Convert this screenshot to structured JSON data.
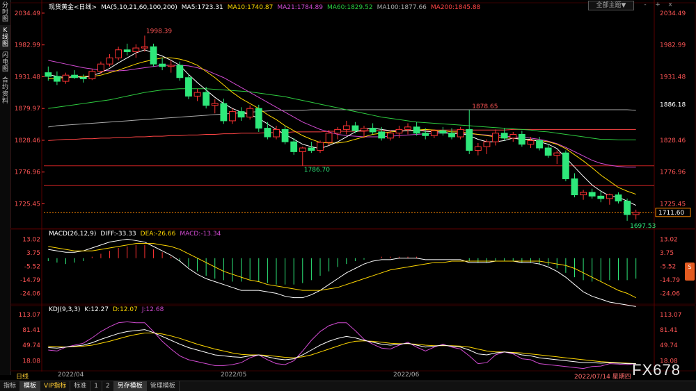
{
  "instrument": "现货黄金",
  "period": "日线",
  "sidebar": {
    "tabs": [
      {
        "label": "分时图",
        "active": false
      },
      {
        "label": "K线图",
        "active": true
      },
      {
        "label": "闪电图",
        "active": false
      },
      {
        "label": "合约资料",
        "active": false
      }
    ]
  },
  "toolbar": {
    "dropdown": "全部主题▼",
    "icons": [
      "-",
      "+",
      "x"
    ]
  },
  "ma_legend": {
    "title": "现货黄金<日线>",
    "params": "MA(5,10,21,60,100,200)",
    "items": [
      {
        "label": "MA5:1723.31",
        "color": "#ffffff"
      },
      {
        "label": "MA10:1740.87",
        "color": "#ffd700"
      },
      {
        "label": "MA21:1784.89",
        "color": "#d24bd2"
      },
      {
        "label": "MA60:1829.52",
        "color": "#2ecc40"
      },
      {
        "label": "MA100:1877.66",
        "color": "#aaaaaa"
      },
      {
        "label": "MA200:1845.88",
        "color": "#ff4444"
      }
    ]
  },
  "macd_legend": {
    "params": "MACD(26,12,9)",
    "items": [
      {
        "label": "DIFF:-33.33",
        "color": "#ffffff"
      },
      {
        "label": "DEA:-26.66",
        "color": "#ffd700"
      },
      {
        "label": "MACD:-13.34",
        "color": "#d24bd2"
      }
    ]
  },
  "kdj_legend": {
    "params": "KDJ(9,3,3)",
    "items": [
      {
        "label": "K:12.27",
        "color": "#ffffff"
      },
      {
        "label": "D:12.07",
        "color": "#ffd700"
      },
      {
        "label": "J:12.68",
        "color": "#d24bd2"
      }
    ]
  },
  "price_axis": {
    "ticks": [
      "2034.49",
      "1982.99",
      "1931.48",
      "1879.97",
      "1828.46",
      "1776.96",
      "1725.45"
    ],
    "right_ticks": [
      "2034.49",
      "1982.99",
      "1931.48",
      "1886.18",
      "1828.46",
      "1776.96",
      "1725.45"
    ],
    "current_price": "1711.60",
    "range": [
      1690,
      2040
    ]
  },
  "macd_axis": {
    "ticks": [
      "13.02",
      "3.75",
      "-5.52",
      "-14.79",
      "-24.06"
    ]
  },
  "kdj_axis": {
    "ticks": [
      "113.07",
      "81.41",
      "49.74",
      "18.08"
    ]
  },
  "annotations": {
    "high": "1998.39",
    "mid_high": "1878.65",
    "low_mid": "1786.70",
    "low": "1697.53"
  },
  "dates": [
    "2022/04",
    "2022/05",
    "2022/06"
  ],
  "date_readout": "2022/07/14 星期四",
  "chart_data": {
    "type": "candlestick",
    "candles": [
      [
        1938,
        1948,
        1925,
        1932
      ],
      [
        1932,
        1940,
        1918,
        1924
      ],
      [
        1924,
        1938,
        1920,
        1934
      ],
      [
        1934,
        1942,
        1928,
        1930
      ],
      [
        1930,
        1935,
        1922,
        1928
      ],
      [
        1928,
        1944,
        1926,
        1940
      ],
      [
        1940,
        1956,
        1936,
        1952
      ],
      [
        1952,
        1968,
        1948,
        1962
      ],
      [
        1962,
        1980,
        1958,
        1975
      ],
      [
        1975,
        1985,
        1966,
        1972
      ],
      [
        1972,
        1984,
        1962,
        1978
      ],
      [
        1978,
        1998,
        1972,
        1980
      ],
      [
        1980,
        1985,
        1948,
        1952
      ],
      [
        1952,
        1962,
        1942,
        1948
      ],
      [
        1948,
        1958,
        1938,
        1950
      ],
      [
        1950,
        1956,
        1925,
        1930
      ],
      [
        1930,
        1935,
        1895,
        1900
      ],
      [
        1900,
        1912,
        1892,
        1906
      ],
      [
        1906,
        1915,
        1880,
        1885
      ],
      [
        1885,
        1895,
        1872,
        1888
      ],
      [
        1888,
        1896,
        1855,
        1860
      ],
      [
        1860,
        1880,
        1855,
        1875
      ],
      [
        1875,
        1882,
        1860,
        1866
      ],
      [
        1866,
        1885,
        1862,
        1880
      ],
      [
        1880,
        1886,
        1842,
        1848
      ],
      [
        1848,
        1858,
        1830,
        1834
      ],
      [
        1834,
        1852,
        1830,
        1846
      ],
      [
        1846,
        1852,
        1822,
        1826
      ],
      [
        1826,
        1832,
        1805,
        1810
      ],
      [
        1810,
        1818,
        1787,
        1816
      ],
      [
        1816,
        1826,
        1808,
        1812
      ],
      [
        1812,
        1828,
        1808,
        1825
      ],
      [
        1825,
        1845,
        1820,
        1840
      ],
      [
        1840,
        1850,
        1830,
        1846
      ],
      [
        1846,
        1860,
        1838,
        1852
      ],
      [
        1852,
        1858,
        1840,
        1844
      ],
      [
        1844,
        1852,
        1832,
        1848
      ],
      [
        1848,
        1856,
        1838,
        1842
      ],
      [
        1842,
        1850,
        1828,
        1832
      ],
      [
        1832,
        1845,
        1828,
        1840
      ],
      [
        1840,
        1852,
        1832,
        1846
      ],
      [
        1846,
        1856,
        1838,
        1850
      ],
      [
        1850,
        1858,
        1836,
        1840
      ],
      [
        1840,
        1848,
        1830,
        1836
      ],
      [
        1836,
        1846,
        1832,
        1844
      ],
      [
        1844,
        1850,
        1836,
        1840
      ],
      [
        1840,
        1848,
        1830,
        1834
      ],
      [
        1834,
        1850,
        1830,
        1846
      ],
      [
        1846,
        1878,
        1806,
        1812
      ],
      [
        1812,
        1824,
        1804,
        1818
      ],
      [
        1818,
        1830,
        1806,
        1826
      ],
      [
        1826,
        1846,
        1820,
        1840
      ],
      [
        1840,
        1848,
        1828,
        1832
      ],
      [
        1832,
        1842,
        1826,
        1838
      ],
      [
        1838,
        1844,
        1818,
        1822
      ],
      [
        1822,
        1834,
        1816,
        1828
      ],
      [
        1828,
        1834,
        1812,
        1816
      ],
      [
        1816,
        1822,
        1800,
        1804
      ],
      [
        1804,
        1812,
        1790,
        1808
      ],
      [
        1808,
        1812,
        1762,
        1766
      ],
      [
        1766,
        1775,
        1736,
        1740
      ],
      [
        1740,
        1748,
        1732,
        1744
      ],
      [
        1744,
        1750,
        1734,
        1738
      ],
      [
        1738,
        1746,
        1728,
        1734
      ],
      [
        1734,
        1742,
        1724,
        1740
      ],
      [
        1740,
        1744,
        1726,
        1730
      ],
      [
        1730,
        1734,
        1698,
        1708
      ],
      [
        1708,
        1716,
        1700,
        1712
      ]
    ],
    "ma5": [
      1935,
      1932,
      1930,
      1932,
      1930,
      1933,
      1938,
      1945,
      1954,
      1962,
      1970,
      1975,
      1970,
      1965,
      1958,
      1950,
      1935,
      1922,
      1910,
      1898,
      1888,
      1880,
      1874,
      1870,
      1864,
      1855,
      1846,
      1838,
      1830,
      1822,
      1818,
      1815,
      1820,
      1826,
      1834,
      1842,
      1846,
      1848,
      1846,
      1844,
      1843,
      1844,
      1845,
      1843,
      1842,
      1842,
      1839,
      1840,
      1836,
      1830,
      1826,
      1826,
      1828,
      1832,
      1830,
      1830,
      1826,
      1822,
      1815,
      1800,
      1785,
      1770,
      1756,
      1746,
      1738,
      1736,
      1730,
      1723
    ],
    "ma10": [
      1928,
      1929,
      1930,
      1931,
      1932,
      1932,
      1934,
      1938,
      1942,
      1947,
      1952,
      1956,
      1959,
      1962,
      1962,
      1960,
      1956,
      1950,
      1940,
      1930,
      1918,
      1906,
      1896,
      1888,
      1880,
      1870,
      1862,
      1852,
      1844,
      1836,
      1830,
      1825,
      1824,
      1824,
      1826,
      1830,
      1834,
      1838,
      1840,
      1842,
      1843,
      1844,
      1845,
      1846,
      1845,
      1844,
      1842,
      1842,
      1840,
      1838,
      1836,
      1834,
      1832,
      1832,
      1830,
      1829,
      1828,
      1826,
      1822,
      1815,
      1805,
      1795,
      1784,
      1772,
      1762,
      1752,
      1746,
      1741
    ],
    "ma21": [
      1958,
      1955,
      1952,
      1949,
      1946,
      1944,
      1942,
      1941,
      1941,
      1942,
      1944,
      1946,
      1948,
      1950,
      1950,
      1950,
      1949,
      1946,
      1942,
      1936,
      1930,
      1922,
      1914,
      1906,
      1898,
      1890,
      1882,
      1874,
      1866,
      1858,
      1852,
      1846,
      1842,
      1838,
      1836,
      1835,
      1834,
      1834,
      1834,
      1835,
      1836,
      1837,
      1838,
      1839,
      1840,
      1840,
      1840,
      1840,
      1839,
      1838,
      1837,
      1836,
      1835,
      1834,
      1833,
      1832,
      1830,
      1827,
      1823,
      1817,
      1810,
      1803,
      1796,
      1791,
      1788,
      1786,
      1785,
      1785
    ],
    "ma60": [
      1880,
      1882,
      1884,
      1886,
      1888,
      1890,
      1892,
      1894,
      1897,
      1900,
      1903,
      1906,
      1908,
      1910,
      1911,
      1912,
      1912,
      1912,
      1912,
      1911,
      1910,
      1909,
      1908,
      1907,
      1905,
      1903,
      1901,
      1899,
      1896,
      1893,
      1890,
      1887,
      1884,
      1881,
      1878,
      1875,
      1872,
      1869,
      1866,
      1864,
      1862,
      1860,
      1858,
      1857,
      1856,
      1855,
      1854,
      1853,
      1852,
      1851,
      1850,
      1849,
      1848,
      1847,
      1846,
      1845,
      1843,
      1842,
      1840,
      1838,
      1836,
      1834,
      1832,
      1830,
      1830,
      1829,
      1829,
      1829
    ],
    "ma100": [
      1850,
      1852,
      1853,
      1854,
      1855,
      1856,
      1857,
      1858,
      1859,
      1860,
      1861,
      1862,
      1863,
      1864,
      1865,
      1866,
      1867,
      1868,
      1869,
      1870,
      1871,
      1872,
      1873,
      1874,
      1875,
      1876,
      1877,
      1877,
      1877,
      1877,
      1878,
      1878,
      1878,
      1878,
      1878,
      1878,
      1878,
      1878,
      1878,
      1878,
      1878,
      1878,
      1878,
      1878,
      1878,
      1878,
      1878,
      1878,
      1878,
      1878,
      1878,
      1878,
      1878,
      1878,
      1878,
      1878,
      1878,
      1878,
      1878,
      1878,
      1878,
      1878,
      1878,
      1878,
      1878,
      1878,
      1878,
      1877
    ],
    "ma200": [
      1828,
      1829,
      1830,
      1830,
      1831,
      1831,
      1832,
      1832,
      1833,
      1833,
      1834,
      1834,
      1835,
      1835,
      1836,
      1836,
      1837,
      1837,
      1838,
      1838,
      1839,
      1839,
      1840,
      1840,
      1840,
      1841,
      1841,
      1841,
      1842,
      1842,
      1842,
      1842,
      1843,
      1843,
      1843,
      1843,
      1843,
      1844,
      1844,
      1844,
      1844,
      1844,
      1844,
      1845,
      1845,
      1845,
      1845,
      1845,
      1845,
      1845,
      1845,
      1845,
      1845,
      1846,
      1846,
      1846,
      1846,
      1846,
      1846,
      1846,
      1846,
      1846,
      1846,
      1846,
      1846,
      1846,
      1846,
      1846
    ],
    "macd_hist": [
      -2,
      -3,
      -4,
      -3,
      -2,
      1,
      3,
      5,
      7,
      8,
      9,
      9,
      6,
      4,
      1,
      -2,
      -6,
      -9,
      -12,
      -14,
      -15,
      -16,
      -16,
      -15,
      -16,
      -17,
      -18,
      -18,
      -18,
      -17,
      -15,
      -12,
      -9,
      -6,
      -4,
      -2,
      -1,
      0,
      1,
      1,
      1,
      1,
      1,
      0,
      0,
      0,
      0,
      0,
      -2,
      -3,
      -3,
      -2,
      -2,
      -2,
      -3,
      -3,
      -4,
      -5,
      -7,
      -10,
      -13,
      -15,
      -16,
      -16,
      -15,
      -15,
      -15,
      -14
    ],
    "macd_diff": [
      6,
      5,
      4,
      4,
      5,
      7,
      9,
      11,
      12,
      13,
      12,
      11,
      8,
      5,
      2,
      -2,
      -7,
      -11,
      -14,
      -16,
      -18,
      -20,
      -22,
      -22,
      -22,
      -23,
      -24,
      -26,
      -27,
      -27,
      -25,
      -22,
      -18,
      -14,
      -10,
      -7,
      -4,
      -2,
      -1,
      -1,
      0,
      0,
      0,
      -1,
      -1,
      -1,
      -1,
      -1,
      -3,
      -3,
      -3,
      -2,
      -2,
      -2,
      -3,
      -3,
      -4,
      -6,
      -9,
      -13,
      -18,
      -23,
      -26,
      -28,
      -30,
      -31,
      -32,
      -33
    ],
    "macd_dea": [
      8,
      7,
      6,
      5,
      5,
      5,
      6,
      7,
      8,
      9,
      10,
      10,
      10,
      9,
      8,
      6,
      3,
      0,
      -3,
      -6,
      -9,
      -11,
      -13,
      -15,
      -16,
      -18,
      -19,
      -20,
      -21,
      -22,
      -22,
      -22,
      -21,
      -20,
      -18,
      -16,
      -14,
      -12,
      -10,
      -8,
      -7,
      -6,
      -5,
      -4,
      -3,
      -3,
      -2,
      -2,
      -2,
      -2,
      -2,
      -2,
      -2,
      -2,
      -2,
      -2,
      -2,
      -3,
      -4,
      -5,
      -7,
      -10,
      -13,
      -16,
      -19,
      -22,
      -24,
      -27
    ],
    "kdj_k": [
      45,
      44,
      46,
      48,
      50,
      55,
      62,
      68,
      74,
      78,
      80,
      82,
      76,
      68,
      60,
      52,
      45,
      40,
      35,
      30,
      28,
      26,
      25,
      28,
      30,
      26,
      22,
      20,
      22,
      30,
      40,
      50,
      58,
      64,
      68,
      65,
      60,
      56,
      52,
      50,
      52,
      54,
      50,
      46,
      48,
      50,
      48,
      46,
      40,
      32,
      30,
      34,
      36,
      34,
      30,
      28,
      24,
      22,
      20,
      18,
      16,
      14,
      14,
      13,
      14,
      13,
      12,
      12
    ],
    "kdj_d": [
      48,
      47,
      46,
      47,
      48,
      50,
      54,
      58,
      63,
      68,
      72,
      75,
      75,
      73,
      69,
      64,
      58,
      52,
      47,
      42,
      38,
      34,
      31,
      30,
      30,
      29,
      27,
      25,
      24,
      26,
      30,
      36,
      42,
      48,
      54,
      58,
      59,
      58,
      56,
      54,
      53,
      53,
      52,
      50,
      49,
      49,
      49,
      48,
      46,
      42,
      38,
      36,
      36,
      35,
      34,
      32,
      30,
      28,
      26,
      24,
      22,
      20,
      18,
      16,
      15,
      14,
      13,
      12
    ],
    "kdj_j": [
      40,
      38,
      46,
      50,
      54,
      65,
      78,
      88,
      96,
      98,
      96,
      96,
      78,
      58,
      42,
      28,
      20,
      16,
      12,
      8,
      8,
      10,
      14,
      24,
      30,
      20,
      12,
      10,
      18,
      38,
      60,
      78,
      90,
      96,
      96,
      80,
      62,
      52,
      44,
      42,
      50,
      56,
      46,
      38,
      46,
      52,
      46,
      42,
      28,
      12,
      14,
      30,
      36,
      32,
      22,
      20,
      12,
      10,
      8,
      6,
      4,
      2,
      6,
      7,
      12,
      11,
      10,
      12
    ]
  }
}
